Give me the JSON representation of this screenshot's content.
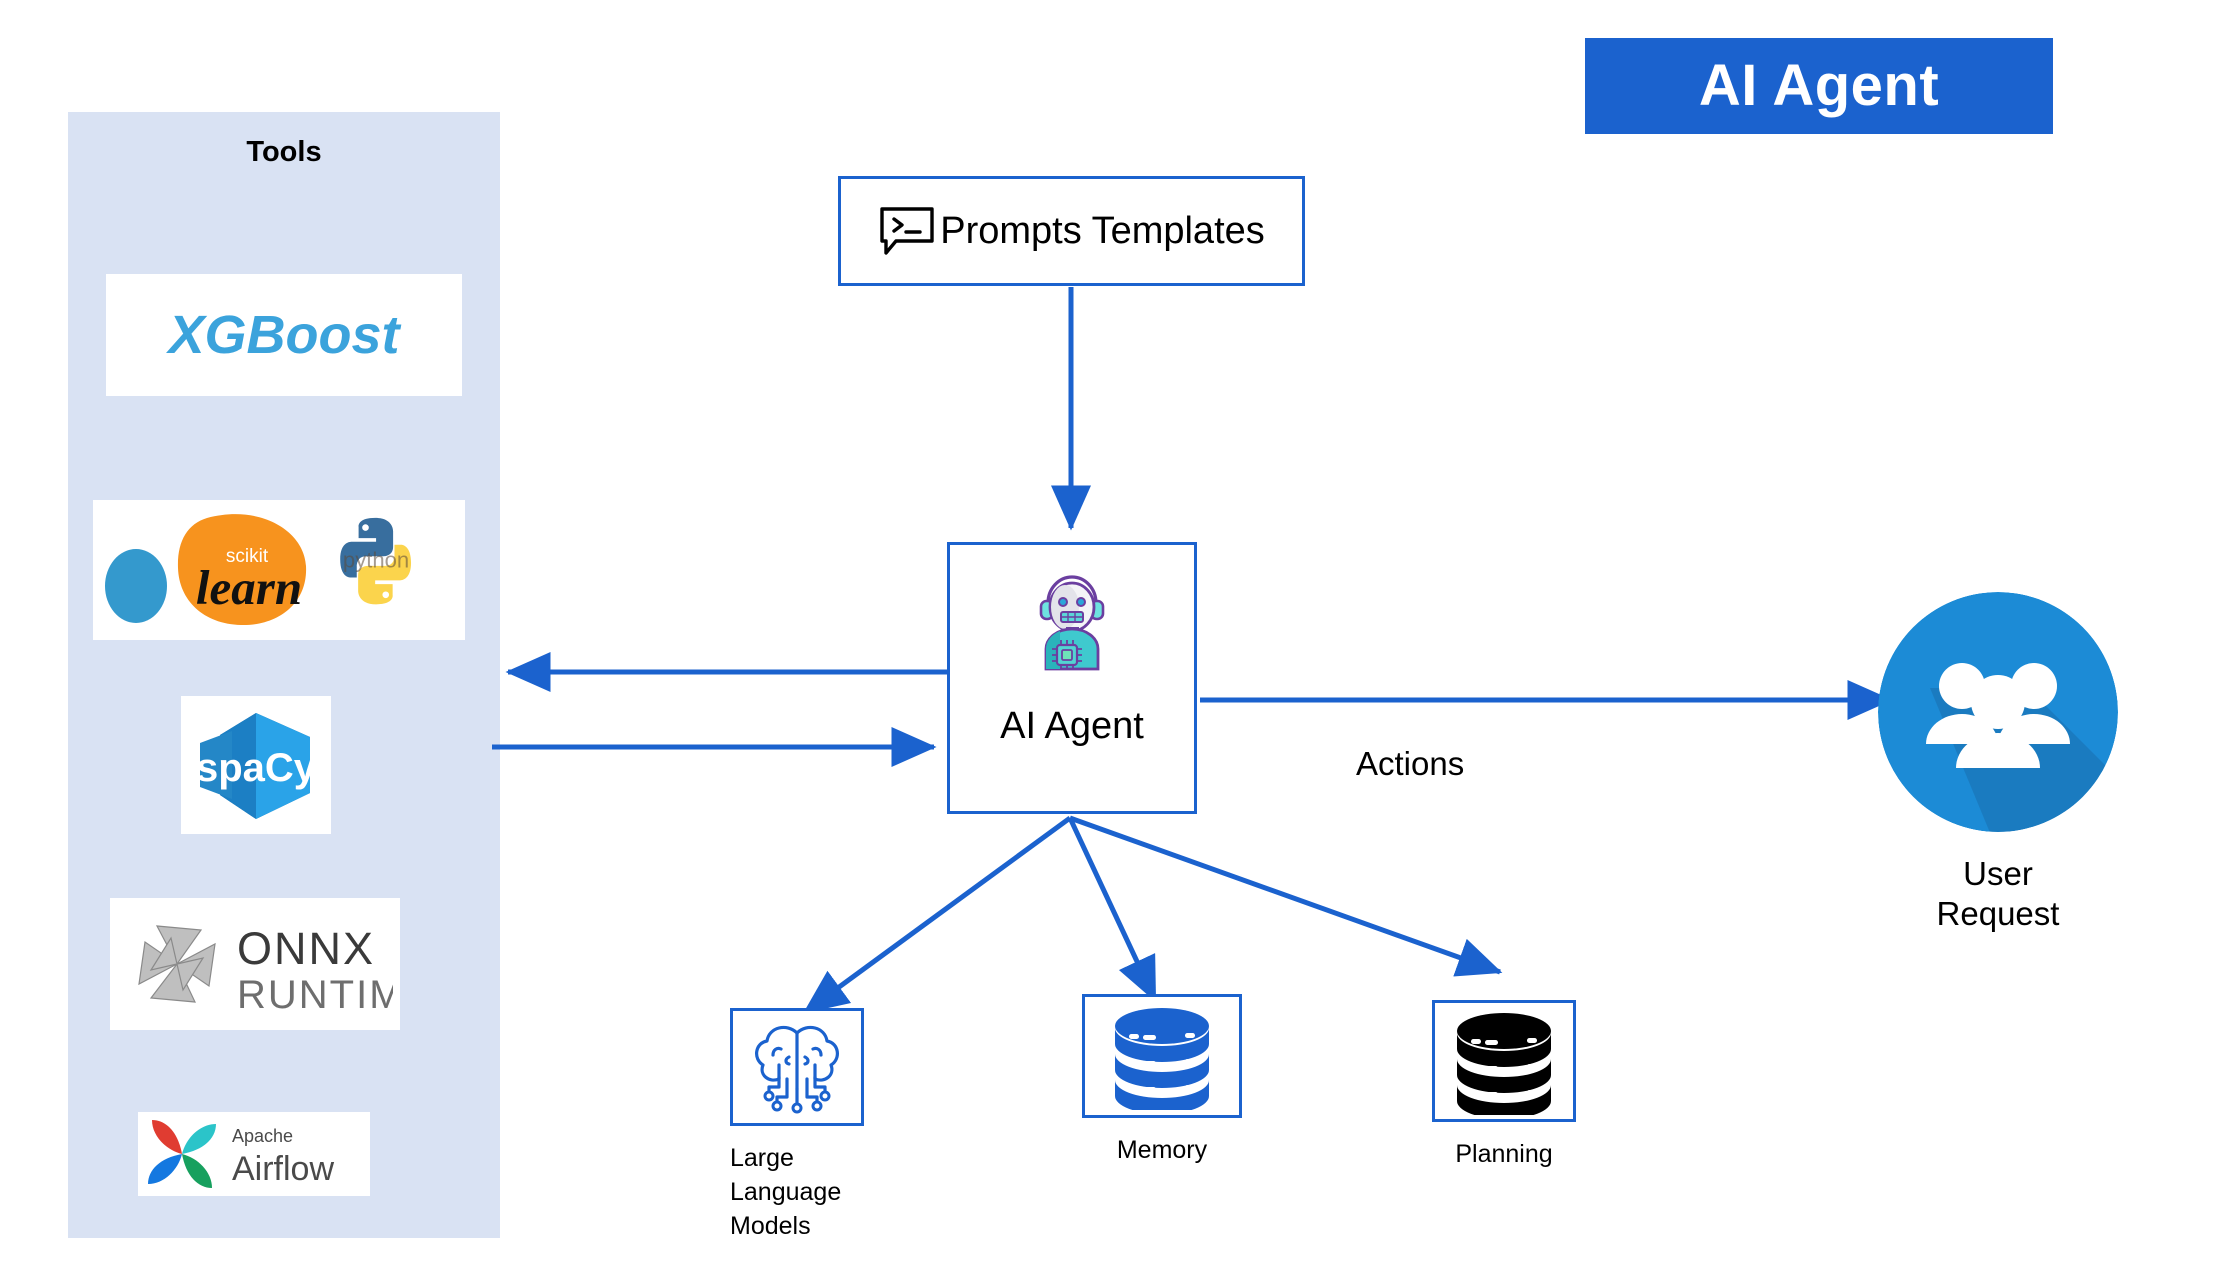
{
  "title": {
    "text": "AI Agent",
    "banner_color": "#1B62CE",
    "text_color": "#ffffff"
  },
  "tools_panel": {
    "heading": "Tools",
    "background_color": "#D9E2F3",
    "items": [
      {
        "name": "XGBoost",
        "icon": "xgboost-logo",
        "wordmark": "XGBoost",
        "color": "#3BA3DC"
      },
      {
        "name": "scikit-learn & Python",
        "icon": "scikit-learn-python-logo",
        "wordmark_top": "scikit",
        "wordmark_bottom": "learn",
        "wordmark_python": "python",
        "color": "#F79939"
      },
      {
        "name": "spaCy",
        "icon": "spacy-logo",
        "wordmark": "spaCy",
        "color": "#1C7FC4"
      },
      {
        "name": "ONNX Runtime",
        "icon": "onnx-runtime-logo",
        "wordmark_top": "ONNX",
        "wordmark_bottom": "RUNTIME",
        "color": "#9A9A9A"
      },
      {
        "name": "Apache Airflow",
        "icon": "apache-airflow-logo",
        "wordmark_top": "Apache",
        "wordmark_bottom": "Airflow",
        "color": "#17A05E"
      }
    ]
  },
  "nodes": {
    "prompts": {
      "label": "Prompts Templates",
      "icon": "terminal-prompt-icon"
    },
    "agent": {
      "label": "AI Agent",
      "icon": "robot-agent-icon"
    },
    "user": {
      "label_line1": "User",
      "label_line2": "Request",
      "icon": "users-group-icon"
    }
  },
  "capabilities": [
    {
      "id": "llm",
      "label": "Large\nLanguage\nModels",
      "icon": "brain-circuit-icon",
      "icon_color": "#1B62CE"
    },
    {
      "id": "memory",
      "label": "Memory",
      "icon": "database-icon",
      "icon_color": "#1B62CE"
    },
    {
      "id": "planning",
      "label": "Planning",
      "icon": "database-icon",
      "icon_color": "#000000"
    }
  ],
  "edges": {
    "actions_label": "Actions",
    "accent_color": "#1B62CE"
  }
}
